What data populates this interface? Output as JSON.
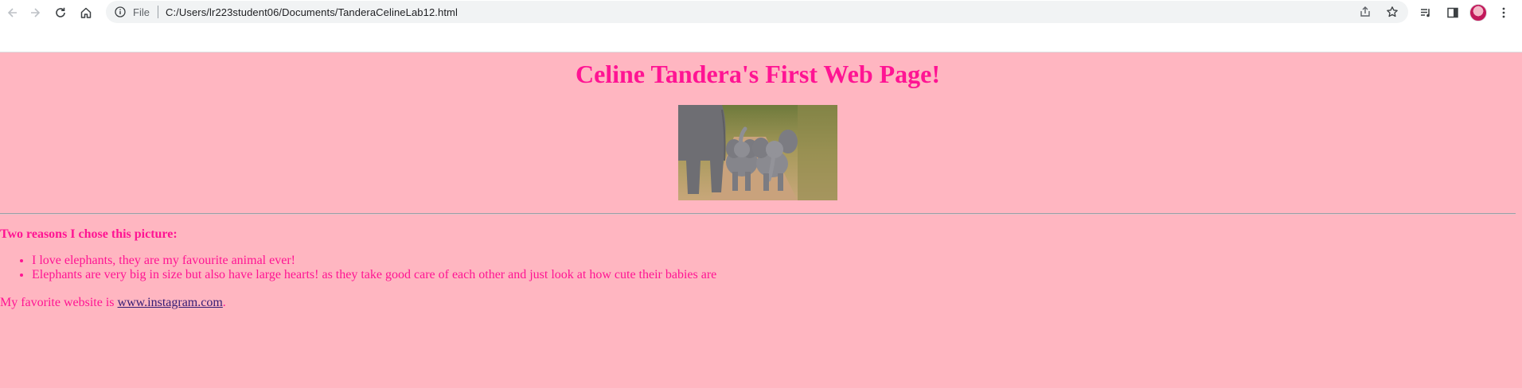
{
  "browser": {
    "scheme_label": "File",
    "url": "C:/Users/lr223student06/Documents/TanderaCelineLab12.html"
  },
  "page": {
    "title": "Celine Tandera's First Web Page!",
    "image_alt": "Elephants",
    "reasons_heading": "Two reasons I chose this picture:",
    "reasons": [
      "I love elephants, they are my favourite animal ever!",
      "Elephants are very big in size but also have large hearts! as they take good care of each other and just look at how cute their babies are"
    ],
    "favorite_prefix": "My favorite website is ",
    "favorite_link": "www.instagram.com",
    "favorite_suffix": "."
  },
  "colors": {
    "background": "#ffb6c1",
    "text": "#ff1493",
    "link": "#351c75"
  },
  "icons": {
    "back": "back-arrow-icon",
    "forward": "forward-arrow-icon",
    "reload": "reload-icon",
    "home": "home-icon",
    "info": "info-icon",
    "share": "share-icon",
    "bookmark": "star-icon",
    "media": "media-controls-icon",
    "side_panel": "side-panel-icon",
    "profile": "profile-avatar",
    "menu": "kebab-menu-icon"
  }
}
